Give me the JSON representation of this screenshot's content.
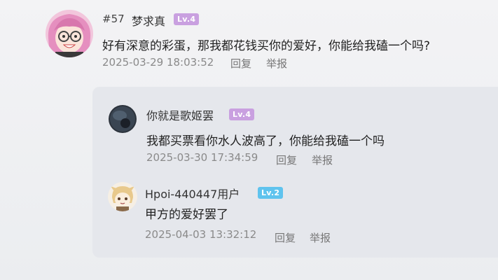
{
  "main_comment": {
    "floor": "#57",
    "username": "梦求真",
    "level": "Lv.4",
    "content": "好有深意的彩蛋，那我都花钱买你的爱好，你能给我磕一个吗?",
    "timestamp": "2025-03-29 18:03:52",
    "reply_label": "回复",
    "report_label": "举报"
  },
  "replies": [
    {
      "username": "你就是歌姬罢",
      "level": "Lv.4",
      "content": "我都买票看你水人波高了，你能给我磕一个吗",
      "timestamp": "2025-03-30 17:34:59",
      "reply_label": "回复",
      "report_label": "举报"
    },
    {
      "username": "Hpoi-440447用户",
      "level": "Lv.2",
      "content": "甲方的爱好罢了",
      "timestamp": "2025-04-03 13:32:12",
      "reply_label": "回复",
      "report_label": "举报"
    }
  ],
  "colors": {
    "lv4_badge": "#c9a0e0",
    "lv2_badge": "#5fc3ee",
    "reply_panel": "#e5e7ec"
  },
  "icons": {
    "main_avatar": "anime-girl-glasses-avatar",
    "reply1_avatar": "dark-round-avatar",
    "reply2_avatar": "anime-chibi-avatar"
  }
}
